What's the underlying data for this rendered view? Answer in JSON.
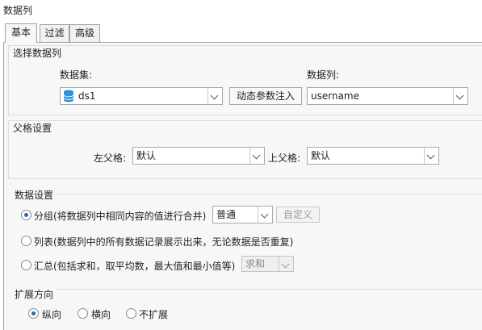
{
  "panel": {
    "title": "数据列"
  },
  "tabs": [
    {
      "label": "基本",
      "active": true
    },
    {
      "label": "过滤",
      "active": false
    },
    {
      "label": "高级",
      "active": false
    }
  ],
  "select_column": {
    "title": "选择数据列",
    "dataset_label": "数据集:",
    "dataset_value": "ds1",
    "dynamic_param_button": "动态参数注入",
    "column_label": "数据列:",
    "column_value": "username"
  },
  "parent_settings": {
    "title": "父格设置",
    "left_parent_label": "左父格:",
    "left_parent_value": "默认",
    "top_parent_label": "上父格:",
    "top_parent_value": "默认"
  },
  "data_settings": {
    "title": "数据设置",
    "group_label": "分组(将数据列中相同内容的值进行合并)",
    "group_mode_value": "普通",
    "custom_button": "自定义",
    "list_label": "列表(数据列中的所有数据记录展示出来，无论数据是否重复)",
    "summary_label": "汇总(包括求和，取平均数，最大值和最小值等)",
    "summary_value": "求和",
    "selected": "group"
  },
  "expand_direction": {
    "title": "扩展方向",
    "vertical_label": "纵向",
    "horizontal_label": "横向",
    "none_label": "不扩展",
    "selected": "vertical"
  },
  "colors": {
    "accent": "#2b62c8",
    "panel_bg": "#f7f7f7",
    "border": "#a9a9a9",
    "db_icon": "#2b8fd9"
  },
  "icons": {
    "dataset": "database-icon",
    "dropdown": "chevron-down-icon"
  }
}
